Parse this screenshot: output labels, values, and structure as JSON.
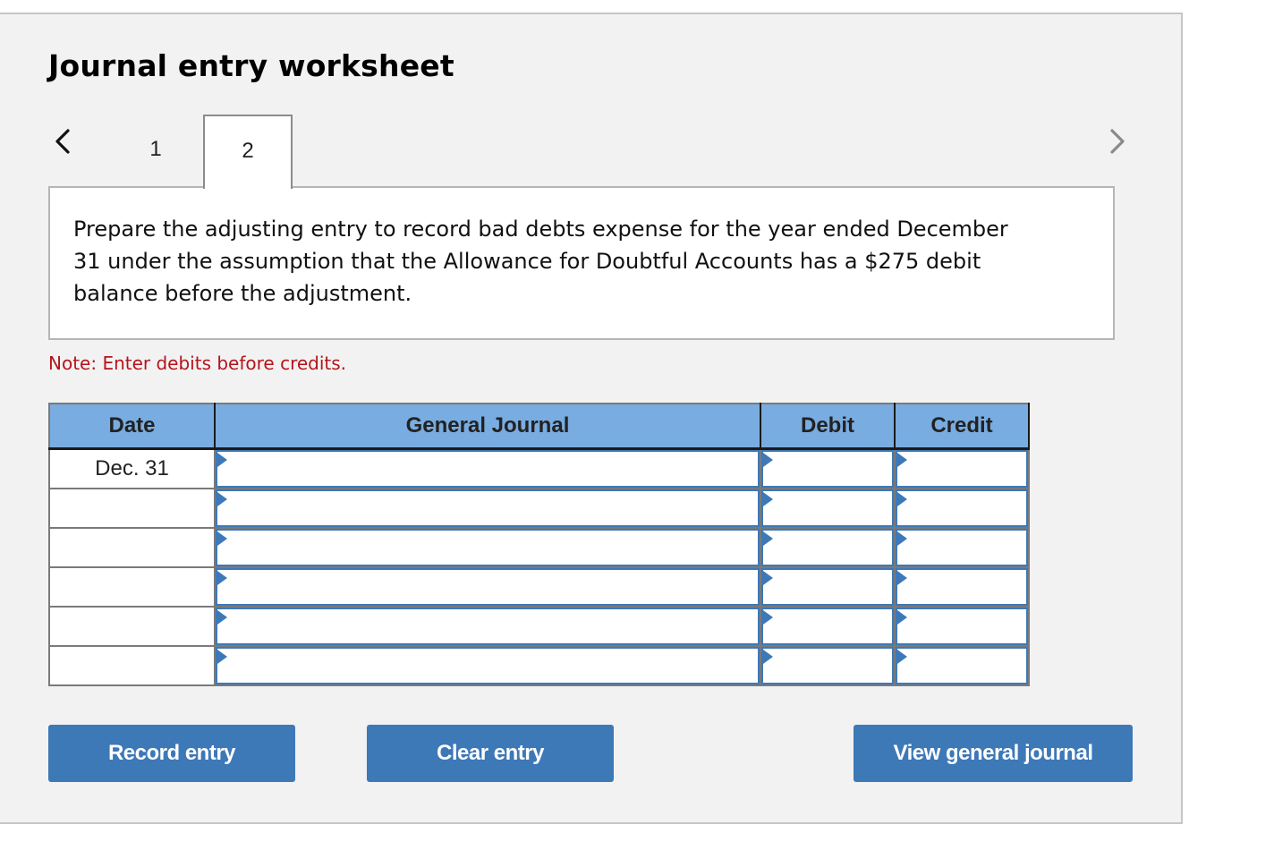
{
  "header": {
    "title": "Journal entry worksheet"
  },
  "pagination": {
    "prev_icon": "chevron-left-icon",
    "next_icon": "chevron-right-icon",
    "tabs": [
      {
        "label": "1",
        "active": false
      },
      {
        "label": "2",
        "active": true
      }
    ]
  },
  "question": {
    "text": "Prepare the adjusting entry to record bad debts expense for the year ended December 31 under the assumption that the Allowance for Doubtful Accounts has a $275 debit balance before the adjustment."
  },
  "note": "Note: Enter debits before credits.",
  "journal": {
    "columns": [
      "Date",
      "General Journal",
      "Debit",
      "Credit"
    ],
    "rows": [
      {
        "date": "Dec. 31",
        "account": "",
        "debit": "",
        "credit": ""
      },
      {
        "date": "",
        "account": "",
        "debit": "",
        "credit": ""
      },
      {
        "date": "",
        "account": "",
        "debit": "",
        "credit": ""
      },
      {
        "date": "",
        "account": "",
        "debit": "",
        "credit": ""
      },
      {
        "date": "",
        "account": "",
        "debit": "",
        "credit": ""
      },
      {
        "date": "",
        "account": "",
        "debit": "",
        "credit": ""
      }
    ]
  },
  "buttons": {
    "record": "Record entry",
    "clear": "Clear entry",
    "view": "View general journal"
  },
  "colors": {
    "accent": "#3d78b7",
    "header_bg": "#79ace0",
    "note": "#b5141c",
    "panel_bg": "#f2f2f2"
  }
}
